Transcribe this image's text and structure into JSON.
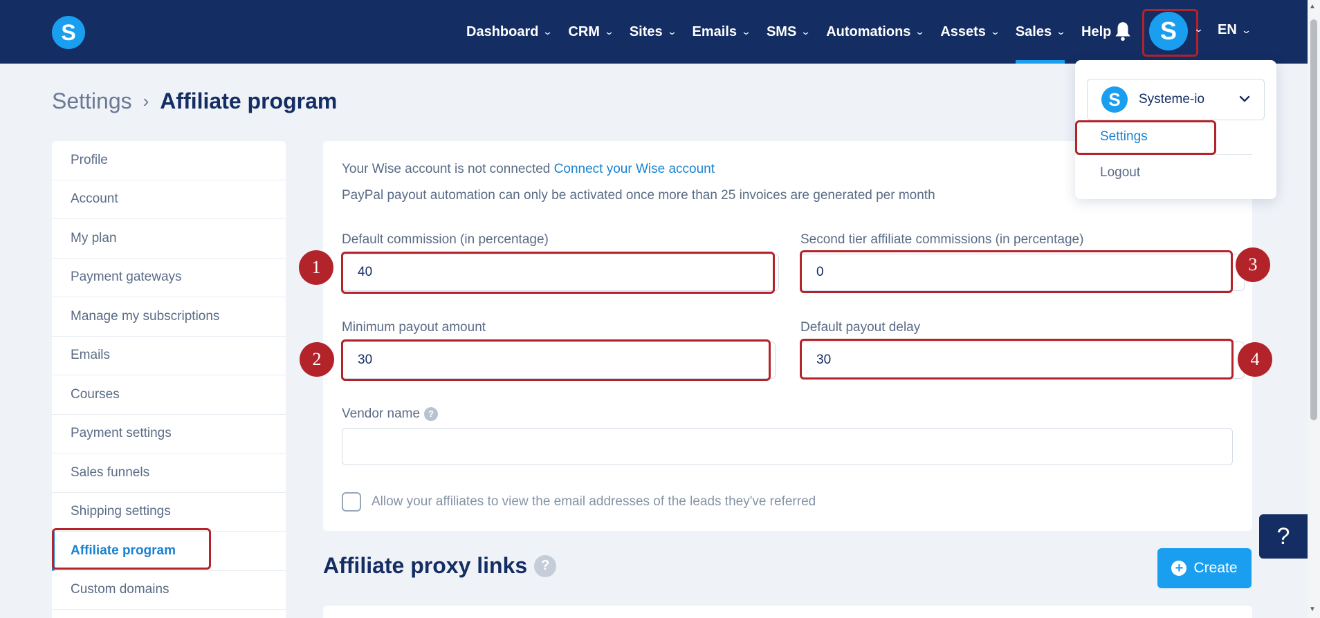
{
  "header": {
    "logo_letter": "S",
    "nav": [
      {
        "label": "Dashboard",
        "has_menu": true
      },
      {
        "label": "CRM",
        "has_menu": true
      },
      {
        "label": "Sites",
        "has_menu": true
      },
      {
        "label": "Emails",
        "has_menu": true
      },
      {
        "label": "SMS",
        "has_menu": true
      },
      {
        "label": "Automations",
        "has_menu": true
      },
      {
        "label": "Assets",
        "has_menu": true
      },
      {
        "label": "Sales",
        "has_menu": true,
        "active": true
      },
      {
        "label": "Help",
        "has_menu": false
      }
    ],
    "avatar_letter": "S",
    "language": "EN"
  },
  "breadcrumb": {
    "root": "Settings",
    "current": "Affiliate program"
  },
  "sidebar": {
    "items": [
      {
        "label": "Profile"
      },
      {
        "label": "Account"
      },
      {
        "label": "My plan"
      },
      {
        "label": "Payment gateways"
      },
      {
        "label": "Manage my subscriptions"
      },
      {
        "label": "Emails"
      },
      {
        "label": "Courses"
      },
      {
        "label": "Payment settings"
      },
      {
        "label": "Sales funnels"
      },
      {
        "label": "Shipping settings"
      },
      {
        "label": "Affiliate program",
        "active": true
      },
      {
        "label": "Custom domains"
      }
    ]
  },
  "form": {
    "wise_text": "Your Wise account is not connected",
    "wise_link": "Connect your Wise account",
    "paypal_text": "PayPal payout automation can only be activated once more than 25 invoices are generated per month",
    "default_commission": {
      "label": "Default commission (in percentage)",
      "value": "40"
    },
    "second_tier": {
      "label": "Second tier affiliate commissions (in percentage)",
      "value": "0"
    },
    "minimum_payout": {
      "label": "Minimum payout amount",
      "value": "30"
    },
    "payout_delay": {
      "label": "Default payout delay",
      "value": "30"
    },
    "vendor_name": {
      "label": "Vendor name",
      "value": ""
    },
    "allow_emails_label": "Allow your affiliates to view the email addresses of the leads they've referred",
    "allow_emails_checked": false
  },
  "annotations": {
    "badge1": "1",
    "badge2": "2",
    "badge3": "3",
    "badge4": "4"
  },
  "proxy_links": {
    "title": "Affiliate proxy links",
    "create_label": "Create"
  },
  "user_menu": {
    "account_name": "Systeme-io",
    "settings_label": "Settings",
    "logout_label": "Logout"
  },
  "help_widget": {
    "label": "?"
  },
  "colors": {
    "navy": "#142d63",
    "accent_blue": "#1a9ff0",
    "link_blue": "#1a82d0",
    "highlight_red": "#b3232a",
    "page_bg": "#eff2f7"
  }
}
